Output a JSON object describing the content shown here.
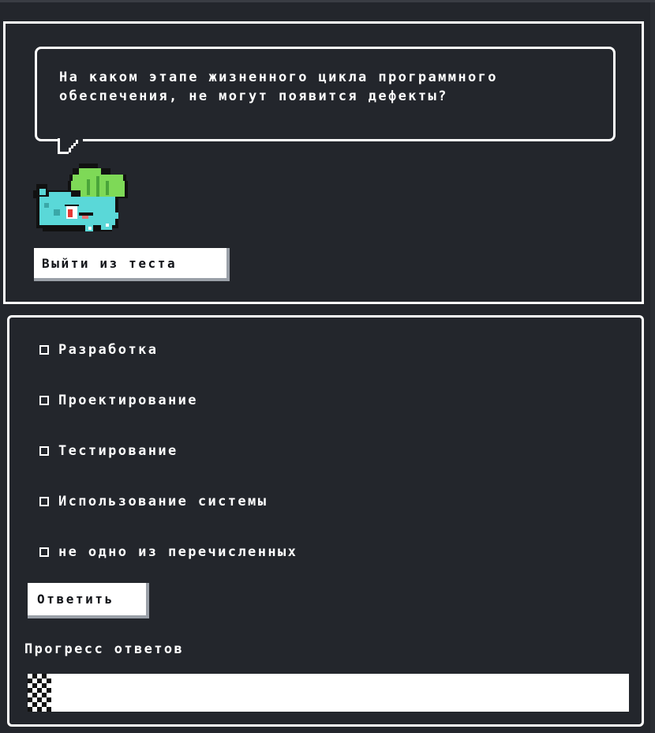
{
  "question": {
    "text": "На каком этапе жизненного цикла программного обеспечения, не могут появится дефекты?"
  },
  "mascot": {
    "icon": "pixel-creature-icon",
    "colors": {
      "body": "#5ad8d8",
      "leaf": "#7ed957",
      "eye": "#e53935"
    }
  },
  "exit_button": {
    "label": "Выйти из теста"
  },
  "options": [
    {
      "label": "Разработка",
      "checked": false
    },
    {
      "label": "Проектирование",
      "checked": false
    },
    {
      "label": "Тестирование",
      "checked": false
    },
    {
      "label": "Использование системы",
      "checked": false
    },
    {
      "label": "не одно из перечисленных",
      "checked": false
    }
  ],
  "answer_button": {
    "label": "Ответить"
  },
  "progress": {
    "title": "Прогресс ответов",
    "fraction": 0.04
  },
  "colors": {
    "background": "#23262c",
    "border": "#ffffff",
    "button": "#ffffff",
    "button_shadow": "#9aa0a8"
  }
}
